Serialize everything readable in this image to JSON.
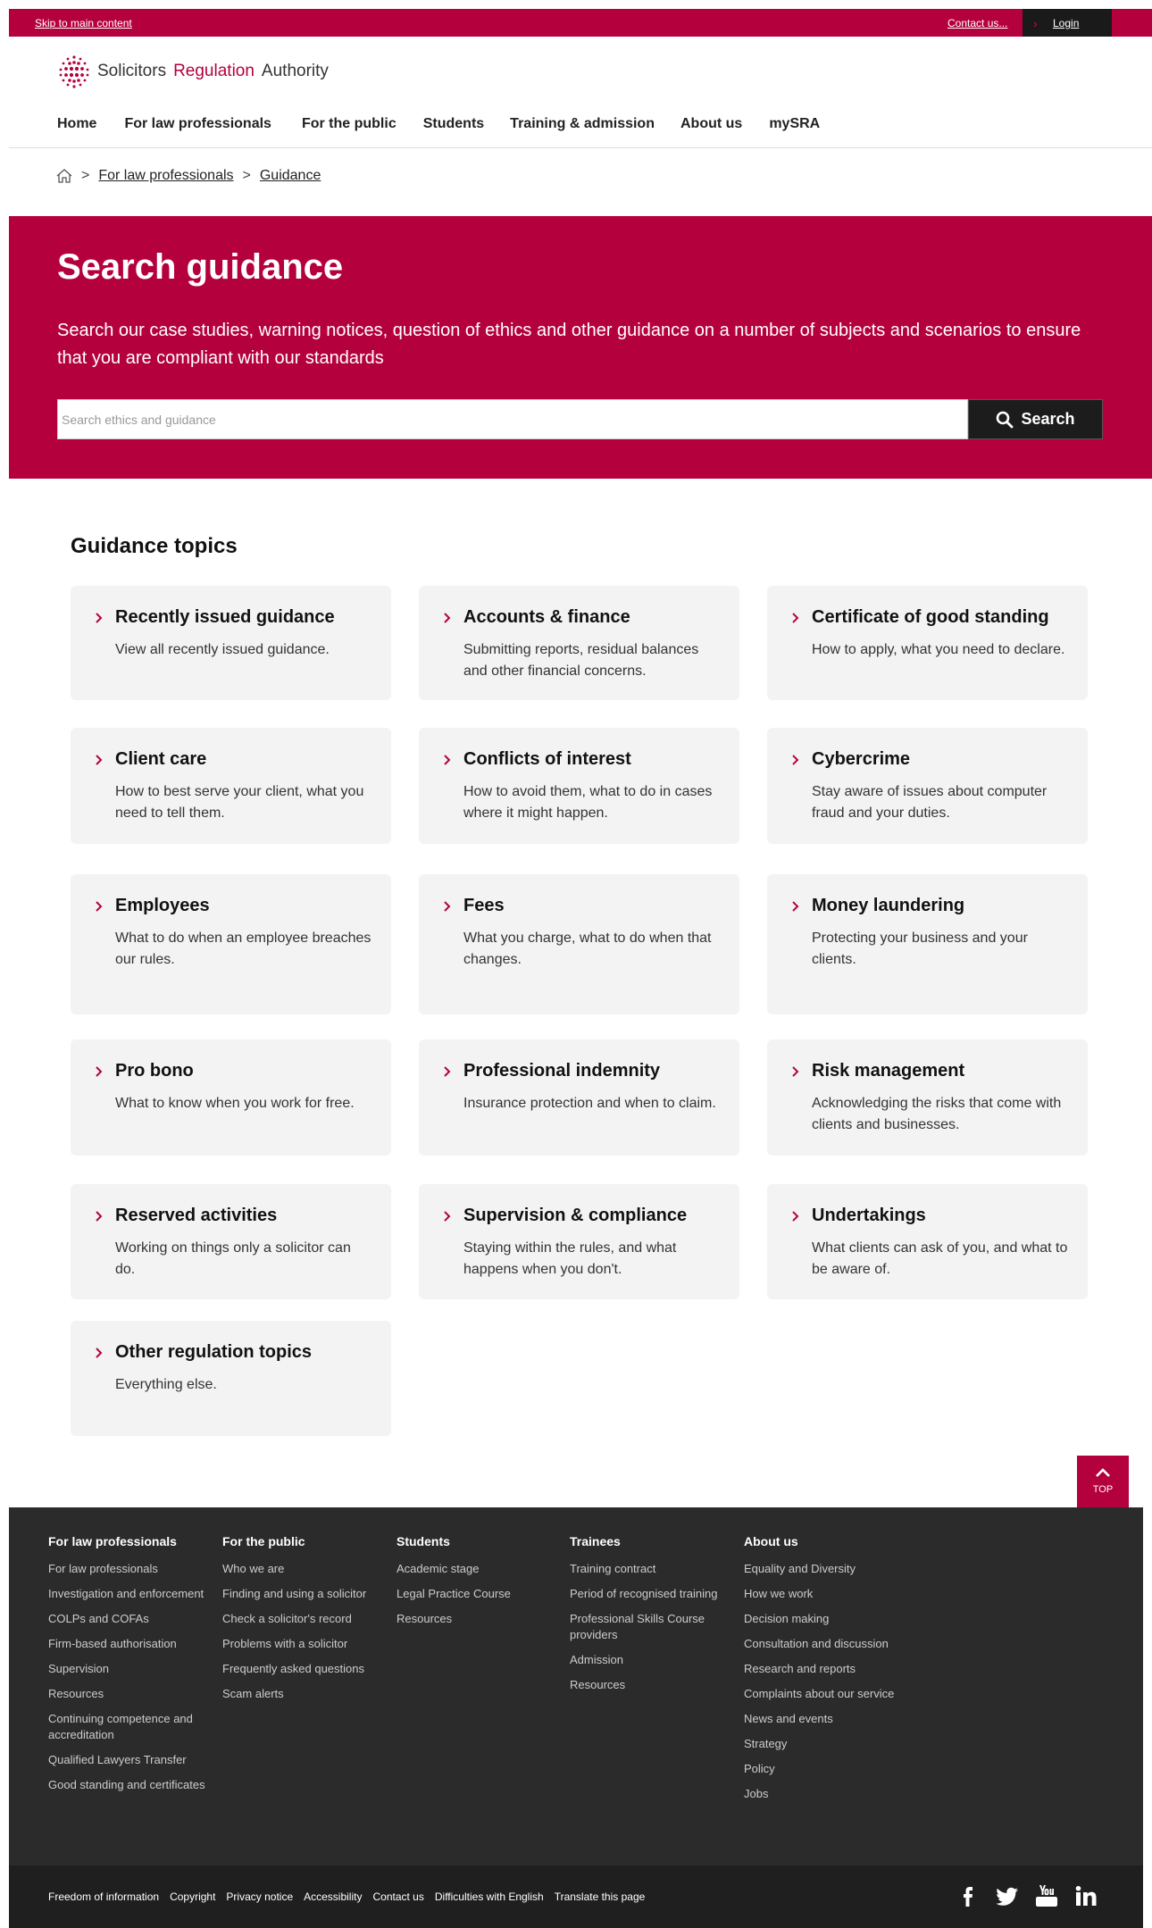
{
  "utility": {
    "skip": "Skip to main content",
    "contact": "Contact us...",
    "login": "Login"
  },
  "brand": {
    "word1": "Solicitors",
    "word2": "Regulation",
    "word3": "Authority",
    "accent": "#b5003e"
  },
  "nav": [
    "Home",
    "For law professionals",
    "For the public",
    "Students",
    "Training & admission",
    "About us",
    "mySRA"
  ],
  "breadcrumb": {
    "items": [
      "For law professionals",
      "Guidance"
    ],
    "separator": ">"
  },
  "hero": {
    "title": "Search guidance",
    "intro": "Search our case studies, warning notices, question of ethics and other guidance on a number of subjects and scenarios to ensure that you are compliant with our standards",
    "search_placeholder": "Search ethics and guidance",
    "search_button": "Search"
  },
  "topics": {
    "heading": "Guidance topics",
    "cards": [
      {
        "title": "Recently issued guidance",
        "desc": "View all recently issued guidance."
      },
      {
        "title": "Accounts & finance",
        "desc": "Submitting reports, residual balances and other financial concerns."
      },
      {
        "title": "Certificate of good standing",
        "desc": "How to apply, what you need to declare."
      },
      {
        "title": "Client care",
        "desc": "How to best serve your client, what you need to tell them."
      },
      {
        "title": "Conflicts of interest",
        "desc": "How to avoid them, what to do in cases where it might happen."
      },
      {
        "title": "Cybercrime",
        "desc": "Stay aware of issues about computer fraud and your duties."
      },
      {
        "title": "Employees",
        "desc": "What to do when an employee breaches our rules."
      },
      {
        "title": "Fees",
        "desc": "What you charge, what to do when that changes."
      },
      {
        "title": "Money laundering",
        "desc": "Protecting your business and your clients."
      },
      {
        "title": "Pro bono",
        "desc": "What to know when you work for free."
      },
      {
        "title": "Professional indemnity",
        "desc": "Insurance protection and when to claim."
      },
      {
        "title": "Risk management",
        "desc": "Acknowledging the risks that come with clients and businesses."
      },
      {
        "title": "Reserved activities",
        "desc": "Working on things only a solicitor can do."
      },
      {
        "title": "Supervision & compliance",
        "desc": "Staying within the rules, and what happens when you don't."
      },
      {
        "title": "Undertakings",
        "desc": "What clients can ask of you, and what to be aware of."
      },
      {
        "title": "Other regulation topics",
        "desc": "Everything else."
      }
    ]
  },
  "totop": "TOP",
  "footer": {
    "columns": [
      {
        "heading": "For law professionals",
        "links": [
          "For law professionals",
          "Investigation and enforcement",
          "COLPs and COFAs",
          "Firm-based authorisation",
          "Supervision",
          "Resources",
          "Continuing competence and accreditation",
          "Qualified Lawyers Transfer",
          "Good standing and certificates"
        ]
      },
      {
        "heading": "For the public",
        "links": [
          "Who we are",
          "Finding and using a solicitor",
          "Check a solicitor's record",
          "Problems with a solicitor",
          "Frequently asked questions",
          "Scam alerts"
        ]
      },
      {
        "heading": "Students",
        "links": [
          "Academic stage",
          "Legal Practice Course",
          "Resources"
        ]
      },
      {
        "heading": "Trainees",
        "links": [
          "Training contract",
          "Period of recognised training",
          "Professional Skills Course providers",
          "Admission",
          "Resources"
        ]
      },
      {
        "heading": "About us",
        "links": [
          "Equality and Diversity",
          "How we work",
          "Decision making",
          "Consultation and discussion",
          "Research and reports",
          "Complaints about our service",
          "News and events",
          "Strategy",
          "Policy",
          "Jobs"
        ]
      }
    ],
    "bottom_links": [
      "Freedom of information",
      "Copyright",
      "Privacy notice",
      "Accessibility",
      "Contact us",
      "Difficulties with English",
      "Translate this page"
    ],
    "social": [
      "facebook-icon",
      "twitter-icon",
      "youtube-icon",
      "linkedin-icon"
    ]
  }
}
